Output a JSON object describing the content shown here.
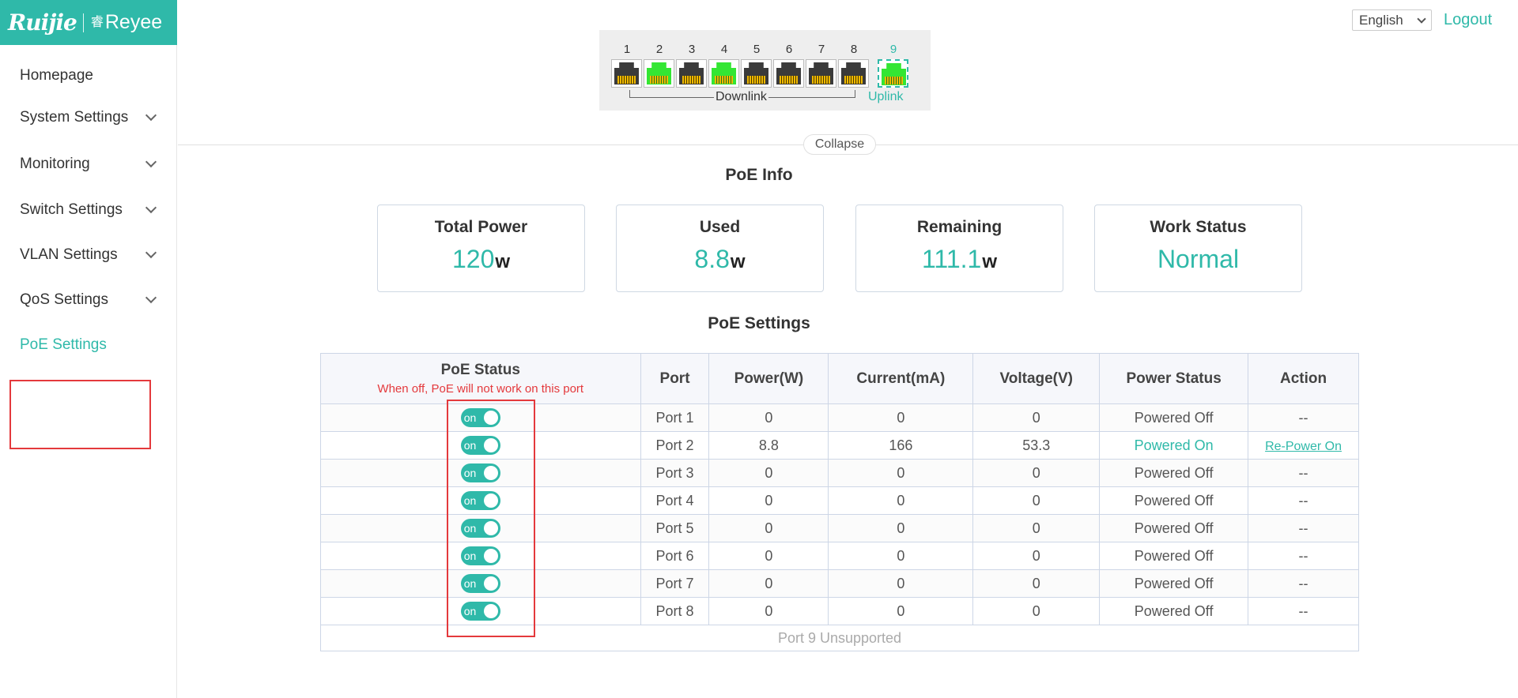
{
  "brand": {
    "logo_main": "Ruijie",
    "logo_glyph": "睿",
    "logo_sub": "Reyee"
  },
  "sidebar": {
    "items": [
      {
        "label": "Homepage",
        "has_children": false
      },
      {
        "label": "System Settings",
        "has_children": true
      },
      {
        "label": "Monitoring",
        "has_children": true
      },
      {
        "label": "Switch Settings",
        "has_children": true
      },
      {
        "label": "VLAN Settings",
        "has_children": true
      },
      {
        "label": "QoS Settings",
        "has_children": true
      },
      {
        "label": "PoE Settings",
        "has_children": false,
        "active": true
      }
    ]
  },
  "header": {
    "language": "English",
    "logout": "Logout"
  },
  "ports": {
    "items": [
      {
        "number": "1",
        "link": false
      },
      {
        "number": "2",
        "link": true
      },
      {
        "number": "3",
        "link": false
      },
      {
        "number": "4",
        "link": true
      },
      {
        "number": "5",
        "link": false
      },
      {
        "number": "6",
        "link": false
      },
      {
        "number": "7",
        "link": false
      },
      {
        "number": "8",
        "link": false
      },
      {
        "number": "9",
        "link": true,
        "uplink": true
      }
    ],
    "downlink_label": "Downlink",
    "uplink_label": "Uplink"
  },
  "collapse_label": "Collapse",
  "poe_info": {
    "title": "PoE Info",
    "cards": [
      {
        "title": "Total Power",
        "value": "120",
        "unit": "w"
      },
      {
        "title": "Used",
        "value": "8.8",
        "unit": "w"
      },
      {
        "title": "Remaining",
        "value": "111.1",
        "unit": "w"
      },
      {
        "title": "Work Status",
        "value": "Normal",
        "unit": ""
      }
    ]
  },
  "poe_settings": {
    "title": "PoE Settings",
    "columns": {
      "status": "PoE Status",
      "status_note": "When off, PoE will not work on this port",
      "port": "Port",
      "power": "Power(W)",
      "current": "Current(mA)",
      "voltage": "Voltage(V)",
      "power_status": "Power Status",
      "action": "Action"
    },
    "switch_label": "on",
    "rows": [
      {
        "port": "Port 1",
        "power": "0",
        "current": "0",
        "voltage": "0",
        "power_status": "Powered Off",
        "action": "--",
        "on": true
      },
      {
        "port": "Port 2",
        "power": "8.8",
        "current": "166",
        "voltage": "53.3",
        "power_status": "Powered On",
        "action": "Re-Power On",
        "on": true
      },
      {
        "port": "Port 3",
        "power": "0",
        "current": "0",
        "voltage": "0",
        "power_status": "Powered Off",
        "action": "--",
        "on": true
      },
      {
        "port": "Port 4",
        "power": "0",
        "current": "0",
        "voltage": "0",
        "power_status": "Powered Off",
        "action": "--",
        "on": true
      },
      {
        "port": "Port 5",
        "power": "0",
        "current": "0",
        "voltage": "0",
        "power_status": "Powered Off",
        "action": "--",
        "on": true
      },
      {
        "port": "Port 6",
        "power": "0",
        "current": "0",
        "voltage": "0",
        "power_status": "Powered Off",
        "action": "--",
        "on": true
      },
      {
        "port": "Port 7",
        "power": "0",
        "current": "0",
        "voltage": "0",
        "power_status": "Powered Off",
        "action": "--",
        "on": true
      },
      {
        "port": "Port 8",
        "power": "0",
        "current": "0",
        "voltage": "0",
        "power_status": "Powered Off",
        "action": "--",
        "on": true
      }
    ],
    "footer": "Port 9 Unsupported"
  },
  "colors": {
    "accent": "#2fb9a9",
    "highlight_red": "#e4393c",
    "link_green": "#33e633"
  }
}
